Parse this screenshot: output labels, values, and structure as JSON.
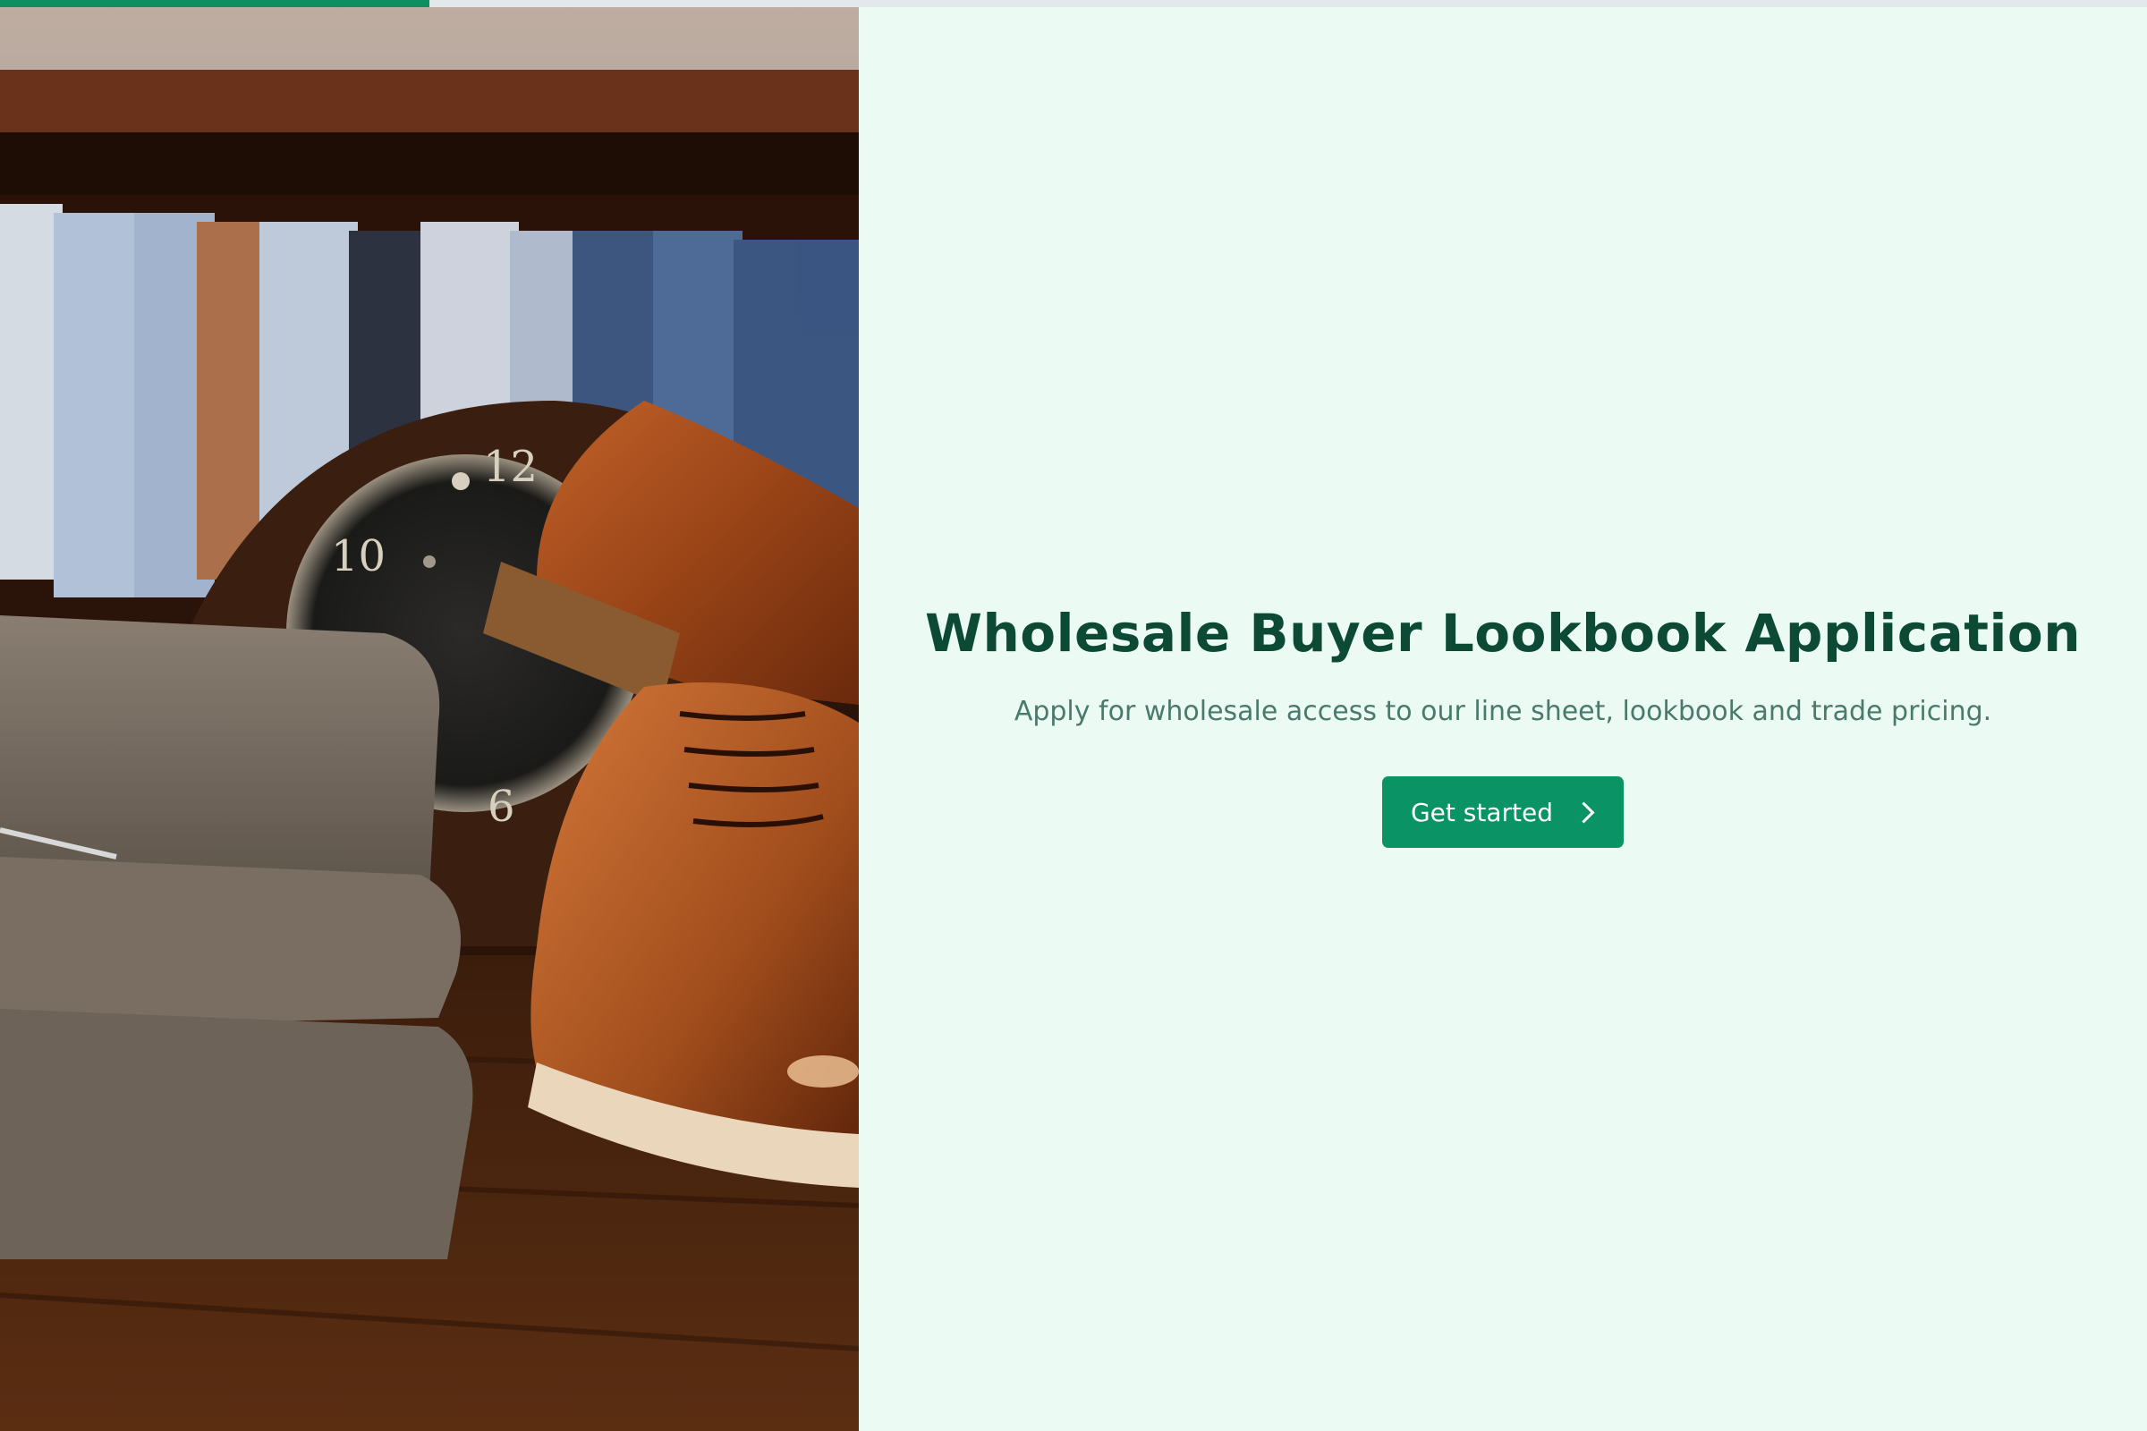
{
  "progress": {
    "fraction": 0.2,
    "color": "#0d8f61",
    "track_color": "#e2e8ec"
  },
  "hero": {
    "image_subject": "shop-display-photo"
  },
  "main": {
    "title": "Wholesale Buyer Lookbook Application",
    "subtitle": "Apply for wholesale access to our line sheet, lookbook and trade pricing.",
    "cta_label": "Get started",
    "cta_icon": "chevron-right-icon"
  },
  "colors": {
    "panel_background": "#ebfbf4",
    "title": "#0c4a36",
    "subtitle": "#4a7a6b",
    "button": "#0a9466"
  }
}
